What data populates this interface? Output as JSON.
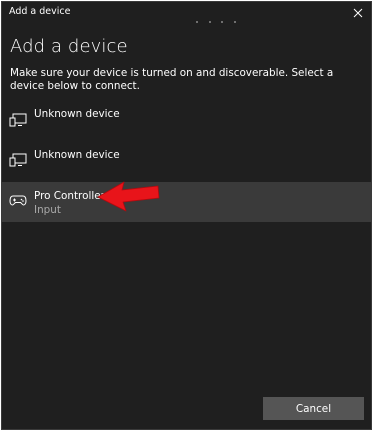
{
  "window": {
    "title": "Add a device",
    "close_icon": "close-icon"
  },
  "main": {
    "heading": "Add a device",
    "instructions": "Make sure your device is turned on and discoverable. Select a device below to connect."
  },
  "devices": [
    {
      "name": "Unknown device",
      "subtitle": "",
      "icon": "display-device-icon",
      "selected": false
    },
    {
      "name": "Unknown device",
      "subtitle": "",
      "icon": "display-device-icon",
      "selected": false
    },
    {
      "name": "Pro Controller",
      "subtitle": "Input",
      "icon": "gamepad-icon",
      "selected": true
    }
  ],
  "annotation": {
    "icon": "red-arrow-pointer-icon",
    "color": "#e8141a"
  },
  "footer": {
    "cancel_label": "Cancel"
  },
  "colors": {
    "background": "#1f1f1f",
    "selected_row": "#3a3a3a",
    "button": "#555555",
    "secondary_text": "#a8a8a8"
  }
}
